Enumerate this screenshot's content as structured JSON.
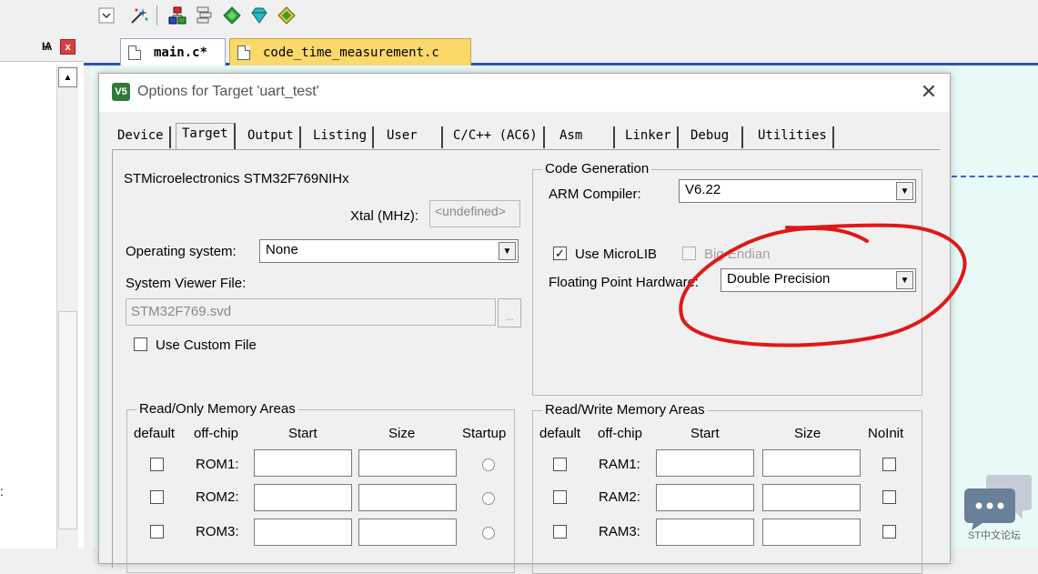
{
  "left_panel": {
    "pin_glyph": "Ѩ",
    "close_glyph": "x",
    "scroll_up_glyph": "▲",
    "fragment_text": ":"
  },
  "editor": {
    "tabs": [
      {
        "label": "main.c*",
        "active": true,
        "color": "#ffffff"
      },
      {
        "label": "code_time_measurement.c",
        "active": false,
        "color": "#fbd86a"
      }
    ]
  },
  "dialog": {
    "title": "Options for Target 'uart_test'",
    "title_icon_text": "V5",
    "close_glyph": "✕",
    "tabs": [
      "Device",
      "Target",
      "Output",
      "Listing",
      "User",
      "C/C++ (AC6)",
      "Asm",
      "Linker",
      "Debug",
      "Utilities"
    ],
    "active_tab": "Target",
    "device_name": "STMicroelectronics STM32F769NIHx",
    "xtal_label": "Xtal (MHz):",
    "xtal_value": "<undefined>",
    "os_label": "Operating system:",
    "os_value": "None",
    "svf_label": "System Viewer File:",
    "svf_value": "STM32F769.svd",
    "browse_label": "...",
    "use_custom_file": {
      "label": "Use Custom File",
      "checked": false
    },
    "code_generation": {
      "title": "Code Generation",
      "compiler_label": "ARM Compiler:",
      "compiler_value": "V6.22",
      "use_microlib": {
        "label": "Use MicroLIB",
        "checked": true,
        "check_glyph": "✓"
      },
      "big_endian": {
        "label": "Big Endian",
        "checked": false,
        "disabled": true
      },
      "fph_label": "Floating Point Hardware:",
      "fph_value": "Double Precision"
    },
    "ro_memory": {
      "title": "Read/Only Memory Areas",
      "headers": [
        "default",
        "off-chip",
        "Start",
        "Size",
        "Startup"
      ],
      "rows": [
        "ROM1:",
        "ROM2:",
        "ROM3:"
      ]
    },
    "rw_memory": {
      "title": "Read/Write Memory Areas",
      "headers": [
        "default",
        "off-chip",
        "Start",
        "Size",
        "NoInit"
      ],
      "rows": [
        "RAM1:",
        "RAM2:",
        "RAM3:"
      ]
    },
    "dropdown_arrow": "▼"
  },
  "annotation_color": "#e01818",
  "forum_badge": {
    "label": "ST中文论坛",
    "icon": "chat-bubble-icon"
  }
}
